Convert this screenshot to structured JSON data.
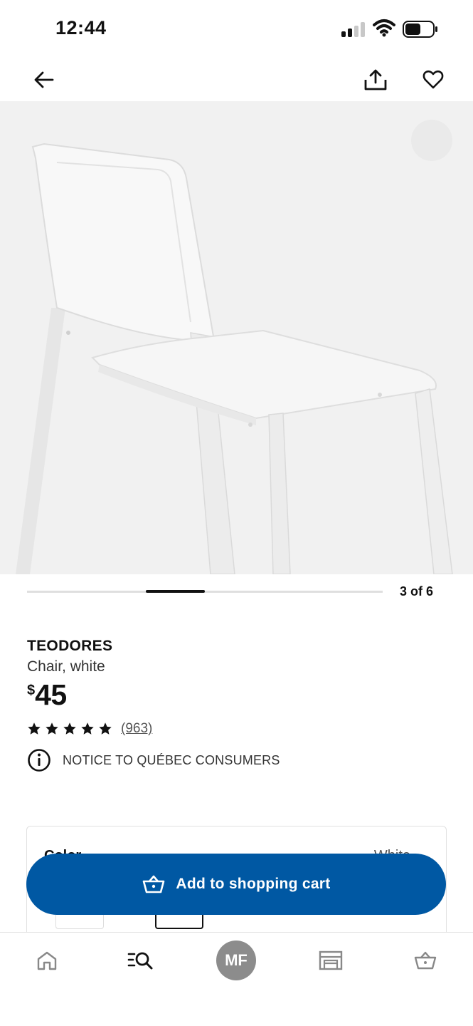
{
  "status_bar": {
    "time": "12:44"
  },
  "nav": {
    "back_icon": "arrow-left-icon",
    "share_icon": "share-icon",
    "favorite_icon": "heart-icon"
  },
  "gallery": {
    "current": 3,
    "total": 6,
    "counter_text": "3 of 6"
  },
  "product": {
    "name": "TEODORES",
    "description": "Chair, white",
    "price_currency": "$",
    "price_amount": "45",
    "rating_stars": 5,
    "review_count": "(963)",
    "notice": "NOTICE TO QUÉBEC CONSUMERS"
  },
  "color_selector": {
    "label": "Color",
    "value": "White"
  },
  "cart_button": {
    "label": "Add to shopping cart",
    "background": "#0058a3"
  },
  "tab_bar": {
    "avatar_initials": "MF",
    "items": [
      "home-icon",
      "search-icon",
      "profile-avatar",
      "store-icon",
      "cart-icon"
    ]
  },
  "colors": {
    "accent": "#0058a3",
    "text": "#111111",
    "image_bg": "#f1f1f1"
  }
}
